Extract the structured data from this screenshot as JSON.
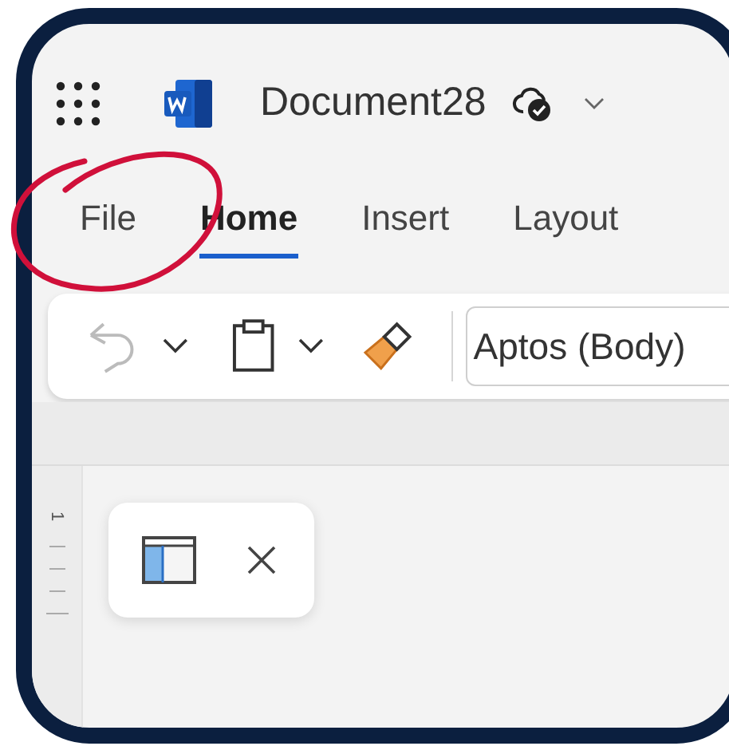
{
  "app": {
    "title": "Document28"
  },
  "tabs": [
    {
      "label": "File",
      "selected": false
    },
    {
      "label": "Home",
      "selected": true
    },
    {
      "label": "Insert",
      "selected": false
    },
    {
      "label": "Layout",
      "selected": false
    }
  ],
  "toolbar": {
    "undo": {
      "disabled": true
    },
    "font": "Aptos (Body)"
  },
  "ruler": {
    "label": "1"
  }
}
